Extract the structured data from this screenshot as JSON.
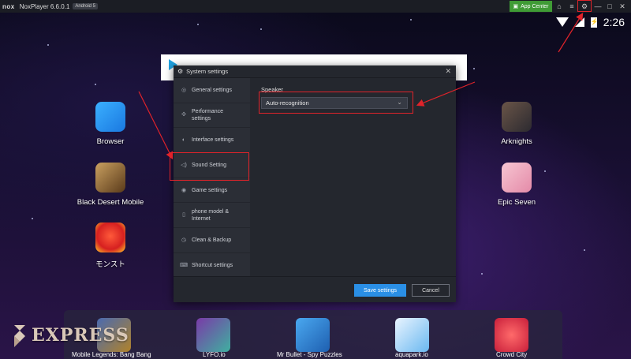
{
  "titlebar": {
    "logo": "nox",
    "title": "NoxPlayer 6.6.0.1",
    "android_badge": "Android 5",
    "app_center_label": "App Center",
    "icons": [
      "shirt-icon",
      "menu-icon",
      "gear-icon",
      "minimize-icon",
      "maximize-icon",
      "close-icon"
    ]
  },
  "statusbar": {
    "time": "2:26",
    "icons": [
      "wifi-icon",
      "signal-icon",
      "battery-icon"
    ]
  },
  "desktop_apps": {
    "left": [
      {
        "label": "Browser",
        "icon": "browser-icon"
      },
      {
        "label": "Black Desert Mobile",
        "icon": "black-desert-icon"
      },
      {
        "label": "モンスト",
        "icon": "monst-icon"
      }
    ],
    "right": [
      {
        "label": "Arknights",
        "icon": "arknights-icon"
      },
      {
        "label": "Epic Seven",
        "icon": "epic-seven-icon"
      }
    ]
  },
  "dialog": {
    "title": "System settings",
    "sidebar": [
      {
        "label": "General settings",
        "icon": "general-icon"
      },
      {
        "label": "Performance settings",
        "icon": "performance-icon"
      },
      {
        "label": "Interface settings",
        "icon": "interface-icon"
      },
      {
        "label": "Sound Setting",
        "icon": "sound-icon",
        "active": true
      },
      {
        "label": "Game settings",
        "icon": "game-icon"
      },
      {
        "label": "phone model & Internet",
        "icon": "phone-icon"
      },
      {
        "label": "Clean & Backup",
        "icon": "clean-icon"
      },
      {
        "label": "Shortcut settings",
        "icon": "shortcut-icon"
      }
    ],
    "speaker_label": "Speaker",
    "speaker_value": "Auto-recognition",
    "save_label": "Save settings",
    "cancel_label": "Cancel"
  },
  "dock": [
    {
      "label": "Mobile Legends: Bang Bang",
      "icon": "mobile-legends-icon"
    },
    {
      "label": "LYFO.io",
      "icon": "lyfo-icon"
    },
    {
      "label": "Mr Bullet - Spy Puzzles",
      "icon": "mr-bullet-icon"
    },
    {
      "label": "aquapark.io",
      "icon": "aquapark-icon"
    },
    {
      "label": "Crowd City",
      "icon": "crowd-city-icon"
    }
  ],
  "watermark": "EXPRESS",
  "colors": {
    "highlight": "#e0232a",
    "accent": "#2a8fe6",
    "app_center": "#3f9b35"
  }
}
